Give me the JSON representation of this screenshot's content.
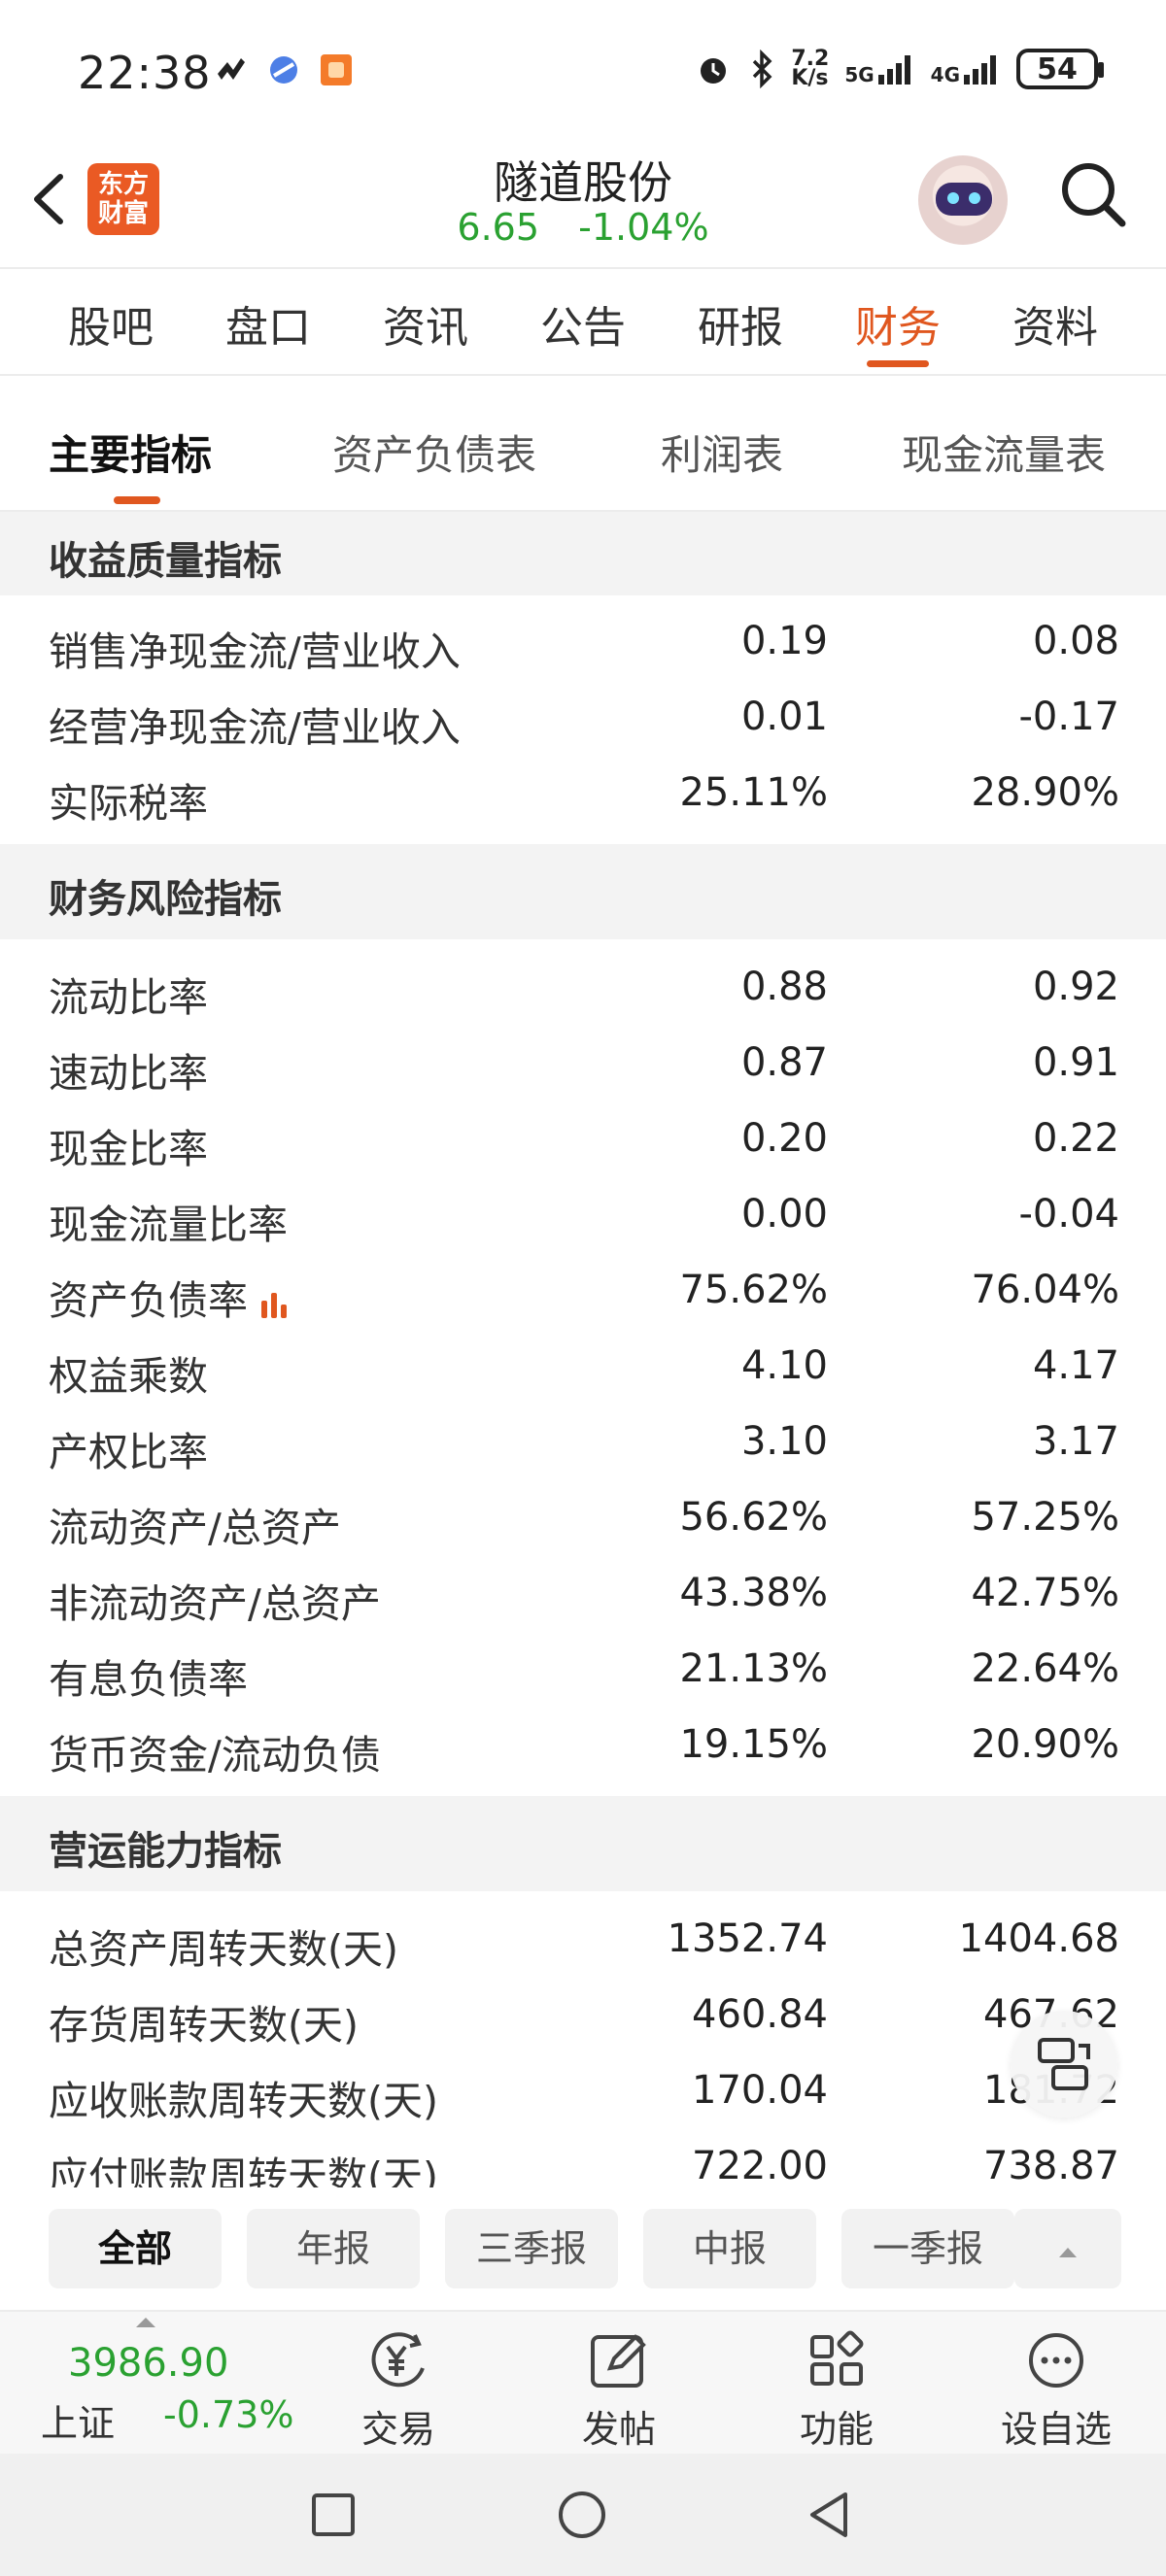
{
  "status_bar": {
    "time": "22:38",
    "net_speed_top": "7.2",
    "net_speed_bottom": "K/s",
    "signal_1": "5G",
    "signal_2": "4G",
    "battery": "54"
  },
  "header": {
    "logo_line1": "东方",
    "logo_line2": "财富",
    "stock_name": "隧道股份",
    "price": "6.65",
    "change_pct": "-1.04%"
  },
  "tabs": [
    {
      "label": "股吧"
    },
    {
      "label": "盘口"
    },
    {
      "label": "资讯"
    },
    {
      "label": "公告"
    },
    {
      "label": "研报"
    },
    {
      "label": "财务",
      "active": true
    },
    {
      "label": "资料"
    }
  ],
  "subtabs": [
    {
      "label": "主要指标",
      "active": true
    },
    {
      "label": "资产负债表"
    },
    {
      "label": "利润表"
    },
    {
      "label": "现金流量表"
    }
  ],
  "sections": [
    {
      "title": "收益质量指标",
      "rows": [
        {
          "label": "销售净现金流/营业收入",
          "v1": "0.19",
          "v2": "0.08"
        },
        {
          "label": "经营净现金流/营业收入",
          "v1": "0.01",
          "v2": "-0.17"
        },
        {
          "label": "实际税率",
          "v1": "25.11%",
          "v2": "28.90%"
        }
      ]
    },
    {
      "title": "财务风险指标",
      "rows": [
        {
          "label": "流动比率",
          "v1": "0.88",
          "v2": "0.92"
        },
        {
          "label": "速动比率",
          "v1": "0.87",
          "v2": "0.91"
        },
        {
          "label": "现金比率",
          "v1": "0.20",
          "v2": "0.22"
        },
        {
          "label": "现金流量比率",
          "v1": "0.00",
          "v2": "-0.04"
        },
        {
          "label": "资产负债率",
          "v1": "75.62%",
          "v2": "76.04%",
          "has_chart_icon": true
        },
        {
          "label": "权益乘数",
          "v1": "4.10",
          "v2": "4.17"
        },
        {
          "label": "产权比率",
          "v1": "3.10",
          "v2": "3.17"
        },
        {
          "label": "流动资产/总资产",
          "v1": "56.62%",
          "v2": "57.25%"
        },
        {
          "label": "非流动资产/总资产",
          "v1": "43.38%",
          "v2": "42.75%"
        },
        {
          "label": "有息负债率",
          "v1": "21.13%",
          "v2": "22.64%"
        },
        {
          "label": "货币资金/流动负债",
          "v1": "19.15%",
          "v2": "20.90%"
        }
      ]
    },
    {
      "title": "营运能力指标",
      "rows": [
        {
          "label": "总资产周转天数(天)",
          "v1": "1352.74",
          "v2": "1404.68"
        },
        {
          "label": "存货周转天数(天)",
          "v1": "460.84",
          "v2": "467.62"
        },
        {
          "label": "应收账款周转天数(天)",
          "v1": "170.04",
          "v2": "181.72"
        },
        {
          "label": "应付账款周转天数(天)",
          "v1": "722.00",
          "v2": "738.87"
        }
      ]
    }
  ],
  "filters": [
    {
      "label": "全部",
      "active": true
    },
    {
      "label": "年报"
    },
    {
      "label": "三季报"
    },
    {
      "label": "中报"
    },
    {
      "label": "一季报"
    }
  ],
  "toolbar": {
    "index_price": "3986.90",
    "index_name": "上证",
    "index_change": "-0.73%",
    "trade_label": "交易",
    "post_label": "发帖",
    "function_label": "功能",
    "watchlist_label": "设自选"
  },
  "colors": {
    "accent": "#e0571f",
    "down_green": "#2aa131",
    "section_bg": "#f3f3f3"
  }
}
